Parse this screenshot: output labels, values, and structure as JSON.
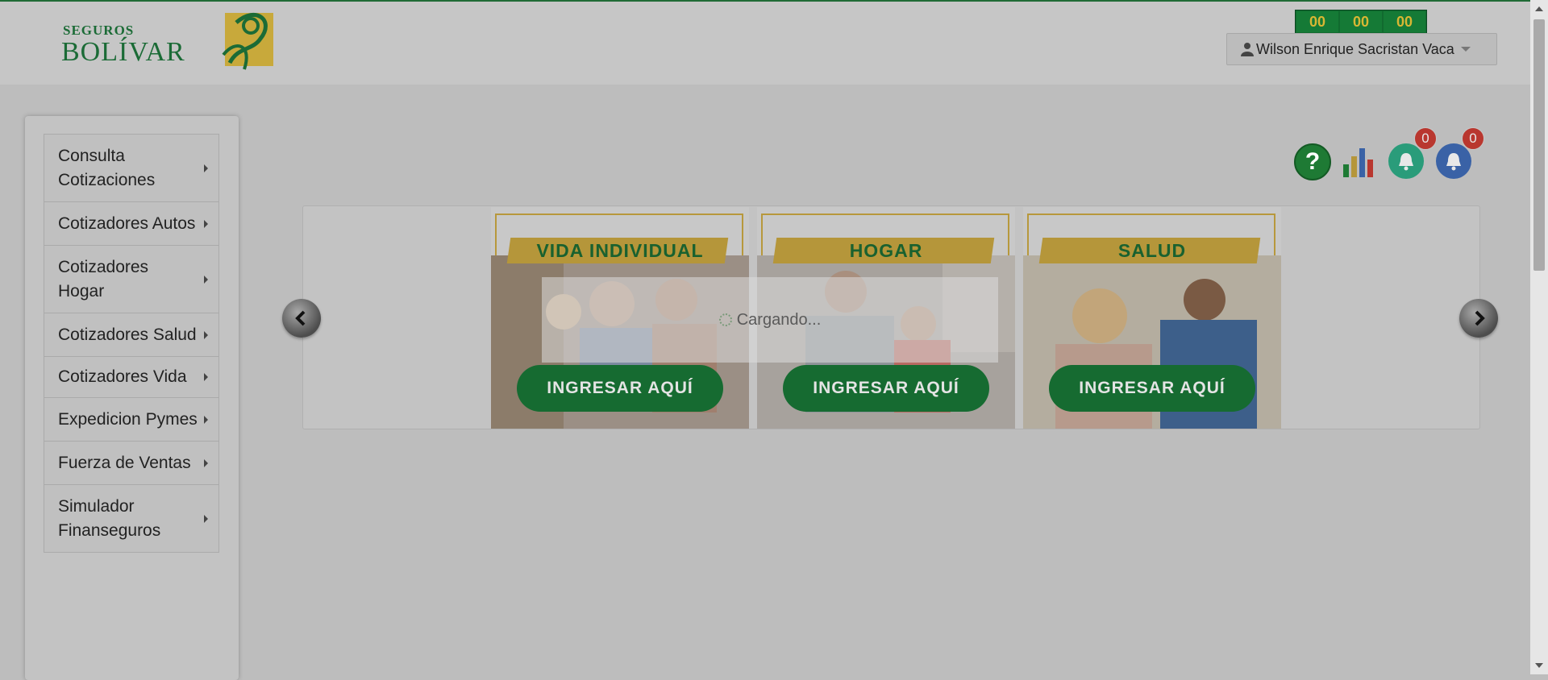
{
  "brand": {
    "line1": "SEGUROS",
    "line2": "BOLÍVAR"
  },
  "timer": {
    "hours": "00",
    "minutes": "00",
    "seconds": "00"
  },
  "user": {
    "name": "Wilson Enrique Sacristan Vaca",
    "icon": "user-icon"
  },
  "sidebar": {
    "items": [
      {
        "label": "Consulta Cotizaciones"
      },
      {
        "label": "Cotizadores Autos"
      },
      {
        "label": "Cotizadores Hogar"
      },
      {
        "label": "Cotizadores Salud"
      },
      {
        "label": "Cotizadores Vida"
      },
      {
        "label": "Expedicion Pymes"
      },
      {
        "label": "Fuerza de Ventas"
      },
      {
        "label": "Simulador Finanseguros"
      }
    ]
  },
  "actions": {
    "help_icon": "?",
    "notifications_count": "0",
    "alerts_count": "0"
  },
  "carousel": {
    "cards": [
      {
        "title": "VIDA INDIVIDUAL",
        "button": "INGRESAR AQUÍ"
      },
      {
        "title": "HOGAR",
        "button": "INGRESAR AQUÍ"
      },
      {
        "title": "SALUD",
        "button": "INGRESAR AQUÍ"
      }
    ]
  },
  "loading": {
    "text": "Cargando..."
  },
  "colors": {
    "brand_green": "#1b6b36",
    "brand_gold": "#b5963a",
    "badge_red": "#b9372f"
  }
}
